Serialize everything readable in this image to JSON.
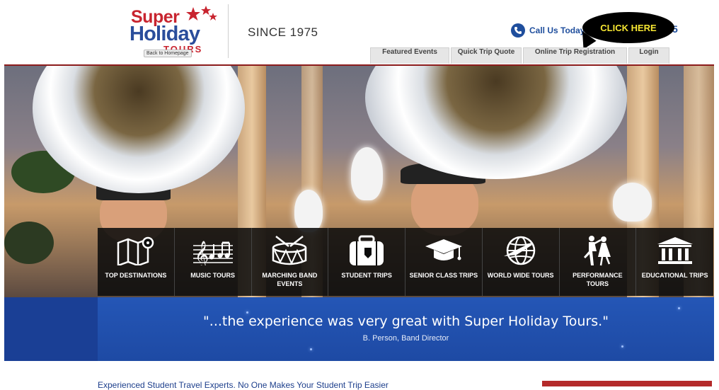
{
  "header": {
    "logo": {
      "line1": "Super",
      "line2": "Holiday",
      "line3": "TOURS",
      "back_link": "Back to Homepage"
    },
    "since": "SINCE 1975",
    "call_text": "Call Us Today",
    "click_here": "CLICK HERE",
    "partial_char": "5"
  },
  "nav": {
    "tabs": [
      "Featured Events",
      "Quick Trip Quote",
      "Online Trip Registration",
      "Login"
    ]
  },
  "tiles": [
    {
      "icon": "map-icon",
      "label": "TOP DESTINATIONS"
    },
    {
      "icon": "music-notes-icon",
      "label": "MUSIC TOURS"
    },
    {
      "icon": "drum-icon",
      "label": "MARCHING BAND EVENTS"
    },
    {
      "icon": "luggage-icon",
      "label": "STUDENT TRIPS"
    },
    {
      "icon": "graduation-cap-icon",
      "label": "SENIOR CLASS TRIPS"
    },
    {
      "icon": "globe-plane-icon",
      "label": "WORLD WIDE TOURS"
    },
    {
      "icon": "dancers-icon",
      "label": "PERFORMANCE TOURS"
    },
    {
      "icon": "museum-icon",
      "label": "EDUCATIONAL TRIPS"
    }
  ],
  "testimonial": {
    "quote": "\"...the experience was very great with Super Holiday Tours.\"",
    "author": "B. Person, Band Director"
  },
  "tagline": "Experienced Student Travel Experts. No One Makes Your Student Trip Easier",
  "colors": {
    "brand_red": "#c8242f",
    "brand_blue": "#2a4d9b",
    "click_yellow": "#f6e632"
  }
}
